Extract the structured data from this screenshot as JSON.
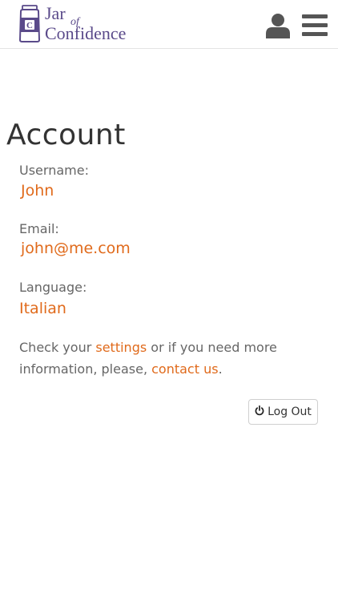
{
  "header": {
    "logo": {
      "line1": "Jar",
      "line2": "of",
      "line3": "Confidence",
      "badge_letter": "C"
    },
    "user_icon": "user-icon",
    "menu_icon": "hamburger-menu-icon"
  },
  "page": {
    "title": "Account",
    "username_label": "Username:",
    "username_value": "John",
    "email_label": "Email:",
    "email_value": "john@me.com",
    "language_label": "Language:",
    "language_value": "Italian",
    "info_part1": "Check your ",
    "settings_link": "settings",
    "info_part2": " or if you need more information, please, ",
    "contact_link": "contact us",
    "info_part3": ".",
    "logout_label": "Log Out"
  },
  "colors": {
    "accent": "#e06a1b",
    "brand_purple": "#5a4a8a",
    "icon_gray": "#555555"
  }
}
